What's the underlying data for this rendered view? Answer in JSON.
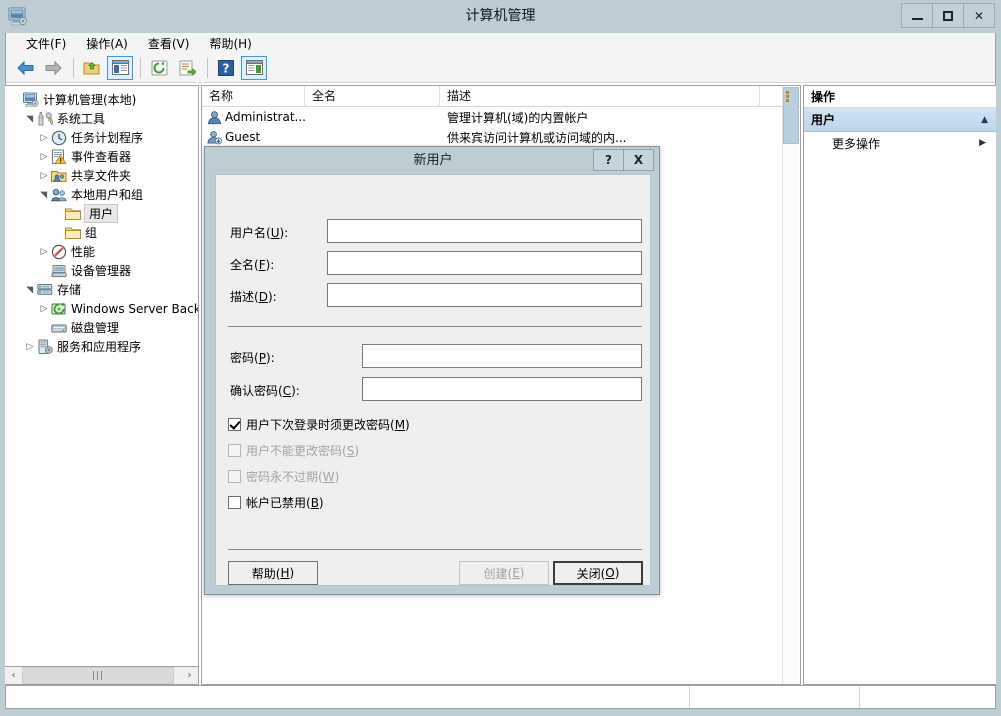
{
  "window": {
    "title": "计算机管理",
    "icon": "computer-management-icon",
    "minimize_label": "最小化",
    "maximize_label": "最大化",
    "close_label": "关闭"
  },
  "menubar": {
    "items": [
      {
        "label": "文件(F)",
        "name": "menu-file"
      },
      {
        "label": "操作(A)",
        "name": "menu-action"
      },
      {
        "label": "查看(V)",
        "name": "menu-view"
      },
      {
        "label": "帮助(H)",
        "name": "menu-help"
      }
    ]
  },
  "toolbar": {
    "buttons": [
      {
        "icon": "back-arrow-icon",
        "framed": false
      },
      {
        "icon": "forward-arrow-icon",
        "framed": false
      },
      {
        "icon": "up-folder-icon",
        "framed": false
      },
      {
        "icon": "show-hide-tree-icon",
        "framed": true
      },
      {
        "icon": "refresh-icon",
        "framed": false
      },
      {
        "icon": "export-list-icon",
        "framed": false
      },
      {
        "icon": "help-icon",
        "framed": false
      },
      {
        "icon": "show-action-pane-icon",
        "framed": true
      }
    ]
  },
  "tree": {
    "nodes": [
      {
        "label": "计算机管理(本地)",
        "indent": 0,
        "twisty": "",
        "icon": "computer-icon",
        "selected": false
      },
      {
        "label": "系统工具",
        "indent": 1,
        "twisty": "expanded",
        "icon": "tools-icon",
        "selected": false
      },
      {
        "label": "任务计划程序",
        "indent": 2,
        "twisty": "collapsed",
        "icon": "clock-icon",
        "selected": false
      },
      {
        "label": "事件查看器",
        "indent": 2,
        "twisty": "collapsed",
        "icon": "event-viewer-icon",
        "selected": false
      },
      {
        "label": "共享文件夹",
        "indent": 2,
        "twisty": "collapsed",
        "icon": "shared-folder-icon",
        "selected": false
      },
      {
        "label": "本地用户和组",
        "indent": 2,
        "twisty": "expanded",
        "icon": "users-groups-icon",
        "selected": false
      },
      {
        "label": "用户",
        "indent": 3,
        "twisty": "",
        "icon": "folder-icon",
        "selected": true
      },
      {
        "label": "组",
        "indent": 3,
        "twisty": "",
        "icon": "folder-icon",
        "selected": false
      },
      {
        "label": "性能",
        "indent": 2,
        "twisty": "collapsed",
        "icon": "performance-icon",
        "selected": false
      },
      {
        "label": "设备管理器",
        "indent": 2,
        "twisty": "",
        "icon": "device-manager-icon",
        "selected": false
      },
      {
        "label": "存储",
        "indent": 1,
        "twisty": "expanded",
        "icon": "storage-icon",
        "selected": false
      },
      {
        "label": "Windows Server Back",
        "indent": 2,
        "twisty": "collapsed",
        "icon": "backup-icon",
        "selected": false
      },
      {
        "label": "磁盘管理",
        "indent": 2,
        "twisty": "",
        "icon": "disk-management-icon",
        "selected": false
      },
      {
        "label": "服务和应用程序",
        "indent": 1,
        "twisty": "collapsed",
        "icon": "services-icon",
        "selected": false
      }
    ],
    "hscroll": {
      "left_arrow": "‹",
      "right_arrow": "›",
      "thumb_grip": "|||"
    }
  },
  "list": {
    "columns": [
      {
        "label": "名称",
        "name": "column-name"
      },
      {
        "label": "全名",
        "name": "column-fullname"
      },
      {
        "label": "描述",
        "name": "column-description"
      }
    ],
    "rows": [
      {
        "name": "Administrat...",
        "fullname": "",
        "description": "管理计算机(域)的内置帐户",
        "icon": "user-account-icon"
      },
      {
        "name": "Guest",
        "fullname": "",
        "description": "供来宾访问计算机或访问域的内...",
        "icon": "guest-account-icon"
      }
    ]
  },
  "actions": {
    "title": "操作",
    "group": {
      "label": "用户",
      "collapse_glyph": "▲"
    },
    "items": [
      {
        "label": "更多操作",
        "submenu_glyph": "▶",
        "name": "action-more-actions"
      }
    ]
  },
  "statusbar": {
    "cells": [
      "",
      "",
      ""
    ]
  },
  "dialog": {
    "title": "新用户",
    "help_btn": "?",
    "close_btn": "X",
    "fields": [
      {
        "label_pre": "用户名(",
        "accel": "U",
        "label_post": "):",
        "value": "",
        "name": "username-field"
      },
      {
        "label_pre": "全名(",
        "accel": "F",
        "label_post": "):",
        "value": "",
        "name": "fullname-field"
      },
      {
        "label_pre": "描述(",
        "accel": "D",
        "label_post": "):",
        "value": "",
        "name": "description-field"
      }
    ],
    "password_fields": [
      {
        "label_pre": "密码(",
        "accel": "P",
        "label_post": "):",
        "value": "",
        "name": "password-field"
      },
      {
        "label_pre": "确认密码(",
        "accel": "C",
        "label_post": "):",
        "value": "",
        "name": "confirm-password-field"
      }
    ],
    "checkboxes": [
      {
        "label_pre": "用户下次登录时须更改密码(",
        "accel": "M",
        "label_post": ")",
        "checked": true,
        "disabled": false,
        "name": "must-change-password-checkbox"
      },
      {
        "label_pre": "用户不能更改密码(",
        "accel": "S",
        "label_post": ")",
        "checked": false,
        "disabled": true,
        "name": "cannot-change-password-checkbox"
      },
      {
        "label_pre": "密码永不过期(",
        "accel": "W",
        "label_post": ")",
        "checked": false,
        "disabled": true,
        "name": "password-never-expires-checkbox"
      },
      {
        "label_pre": "帐户已禁用(",
        "accel": "B",
        "label_post": ")",
        "checked": false,
        "disabled": false,
        "name": "account-disabled-checkbox"
      }
    ],
    "buttons": [
      {
        "label_pre": "帮助(",
        "accel": "H",
        "label_post": ")",
        "style": "normal",
        "name": "help-button"
      },
      {
        "label_pre": "创建(",
        "accel": "E",
        "label_post": ")",
        "style": "disabled",
        "name": "create-button"
      },
      {
        "label_pre": "关闭(",
        "accel": "O",
        "label_post": ")",
        "style": "default",
        "name": "close-button"
      }
    ]
  },
  "colors": {
    "window_chrome": "#bccdd4",
    "dialog_body": "#efefef",
    "accent_blue": "#3c9ad4",
    "action_group": "#bed6ea",
    "scrollbar_thumb": "#b8cfe0"
  }
}
